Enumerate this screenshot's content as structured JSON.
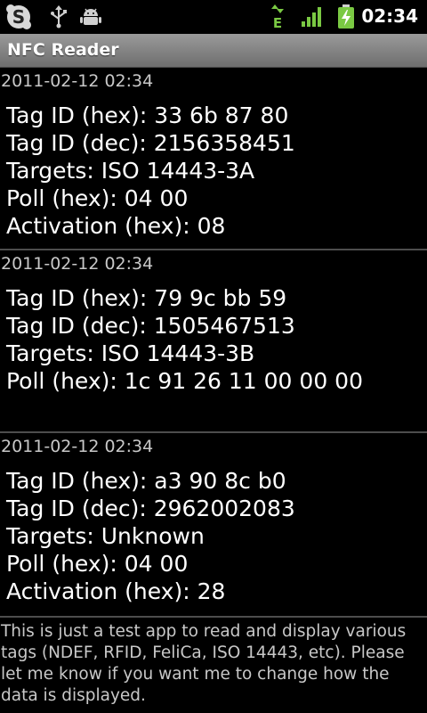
{
  "status_bar": {
    "time": "02:34",
    "icons": [
      "skype-icon",
      "usb-icon",
      "android-debug-icon",
      "edge-data-icon",
      "signal-icon",
      "battery-charging-icon"
    ],
    "colors": {
      "signal": "#7ac943",
      "battery": "#7ac943"
    }
  },
  "app": {
    "title": "NFC Reader"
  },
  "tags": [
    {
      "timestamp": "2011-02-12 02:34",
      "lines": [
        "Tag ID (hex): 33 6b 87 80",
        "Tag ID (dec): 2156358451",
        "Targets: ISO 14443-3A",
        "Poll (hex): 04 00",
        "Activation (hex): 08"
      ]
    },
    {
      "timestamp": "2011-02-12 02:34",
      "lines": [
        "Tag ID (hex): 79 9c bb 59",
        "Tag ID (dec): 1505467513",
        "Targets: ISO 14443-3B",
        "Poll (hex): 1c 91 26 11 00 00 00"
      ]
    },
    {
      "timestamp": "2011-02-12 02:34",
      "lines": [
        "Tag ID (hex): a3 90 8c b0",
        "Tag ID (dec): 2962002083",
        "Targets: Unknown",
        "Poll (hex): 04 00",
        "Activation (hex): 28"
      ]
    }
  ],
  "footer": {
    "text": "This is just a test app to read and display various tags (NDEF, RFID, FeliCa, ISO 14443, etc). Please let me know if you want me to change how the data is displayed."
  }
}
